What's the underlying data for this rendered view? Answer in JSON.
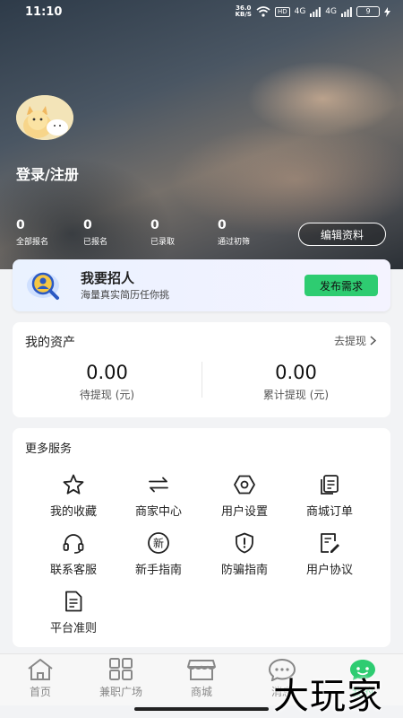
{
  "status_bar": {
    "time": "11:10",
    "net_speed_value": "36.0",
    "net_speed_unit": "KB/S",
    "hd_label": "HD",
    "signal1": "4G",
    "signal2": "4G",
    "battery": "9"
  },
  "profile": {
    "login_label": "登录/注册",
    "avatar_icon": "cat-avatar-icon"
  },
  "stats": [
    {
      "value": "0",
      "label": "全部报名"
    },
    {
      "value": "0",
      "label": "已报名"
    },
    {
      "value": "0",
      "label": "已录取"
    },
    {
      "value": "0",
      "label": "通过初筛"
    }
  ],
  "edit_profile_label": "编辑资料",
  "recruit": {
    "title": "我要招人",
    "subtitle": "海量真实简历任你挑",
    "button": "发布需求"
  },
  "assets": {
    "title": "我的资产",
    "withdraw_link": "去提现",
    "pending": {
      "value": "0.00",
      "label": "待提现 (元)"
    },
    "total": {
      "value": "0.00",
      "label": "累计提现 (元)"
    }
  },
  "services": {
    "title": "更多服务",
    "items": [
      {
        "label": "我的收藏",
        "icon": "star-icon"
      },
      {
        "label": "商家中心",
        "icon": "swap-icon"
      },
      {
        "label": "用户设置",
        "icon": "settings-hex-icon"
      },
      {
        "label": "商城订单",
        "icon": "order-icon"
      },
      {
        "label": "联系客服",
        "icon": "headset-icon"
      },
      {
        "label": "新手指南",
        "icon": "new-badge-icon"
      },
      {
        "label": "防骗指南",
        "icon": "shield-alert-icon"
      },
      {
        "label": "用户协议",
        "icon": "agreement-icon"
      },
      {
        "label": "平台准则",
        "icon": "document-icon"
      }
    ],
    "new_glyph": "新"
  },
  "tabbar": {
    "items": [
      {
        "label": "首页",
        "icon": "home-icon"
      },
      {
        "label": "兼职广场",
        "icon": "grid-icon"
      },
      {
        "label": "商城",
        "icon": "shop-icon"
      },
      {
        "label": "消息",
        "icon": "chat-icon"
      },
      {
        "label": "我的",
        "icon": "profile-icon"
      }
    ]
  },
  "watermark": "大玩家",
  "colors": {
    "accent": "#2ecc71",
    "text": "#222222",
    "muted": "#888888"
  }
}
